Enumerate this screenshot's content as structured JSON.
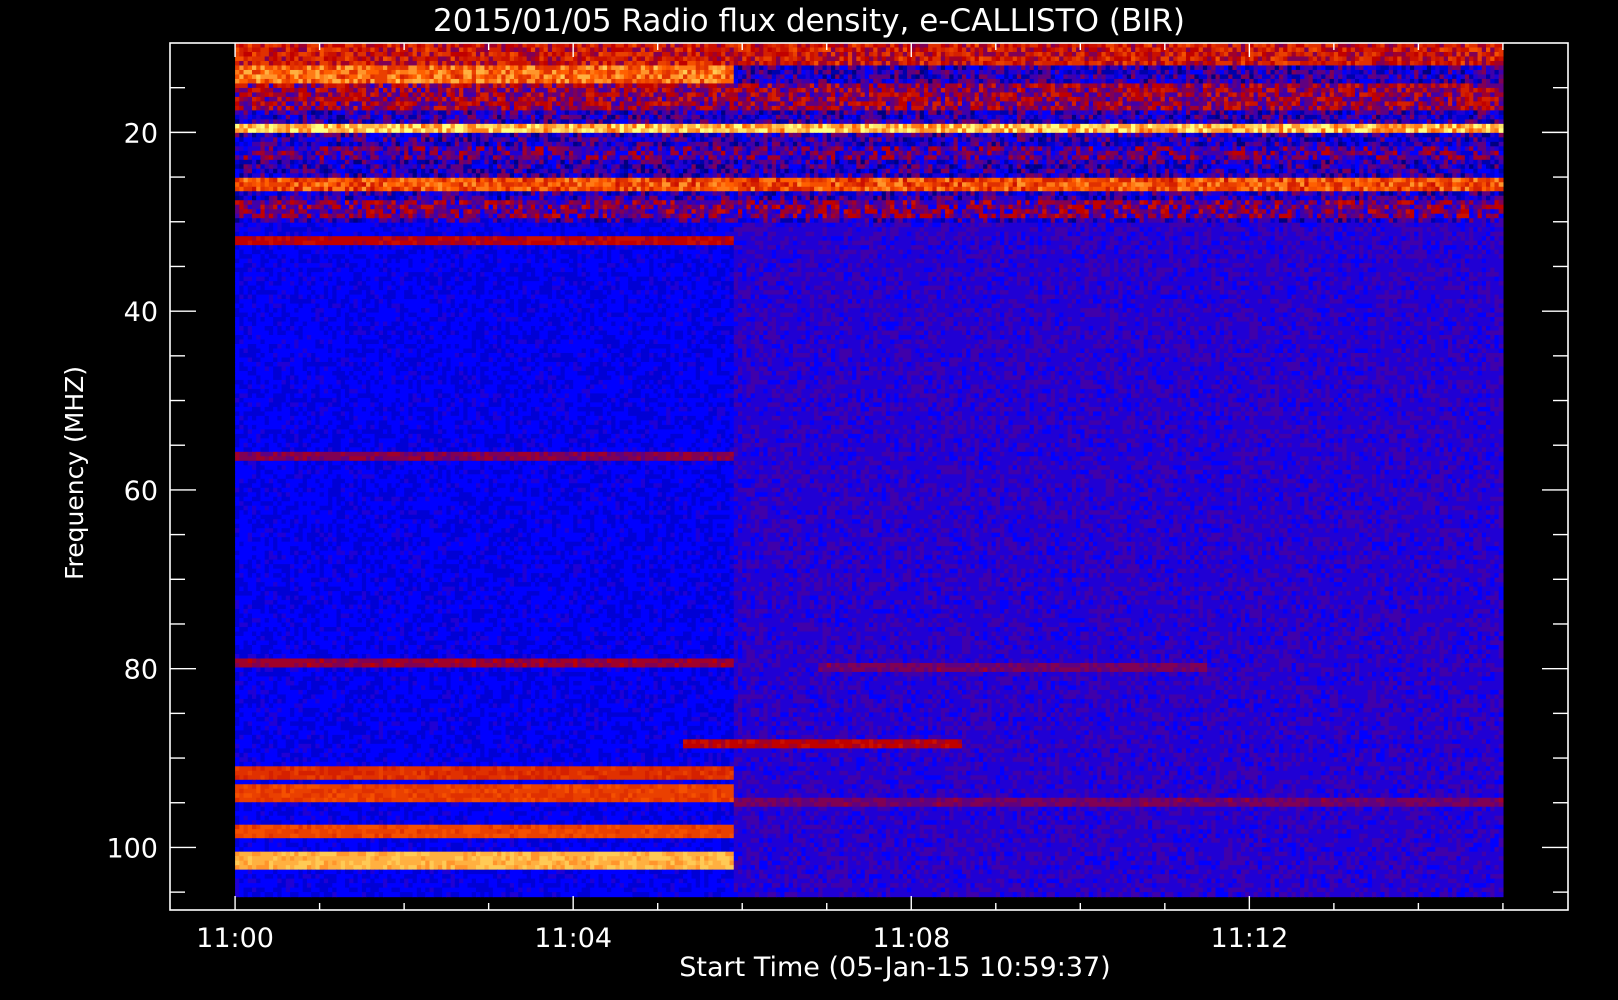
{
  "chart_data": {
    "type": "heatmap",
    "title": "2015/01/05  Radio flux density, e-CALLISTO (BIR)",
    "xlabel": "Start Time (05-Jan-15 10:59:37)",
    "ylabel": "Frequency (MHZ)",
    "x_ticks": [
      "11:00",
      "11:04",
      "11:08",
      "11:12"
    ],
    "x_tick_minutes": [
      0,
      4,
      8,
      12
    ],
    "x_range_minutes": [
      -0.77,
      15.77
    ],
    "data_x_range_minutes": [
      0,
      15
    ],
    "y_ticks": [
      20,
      40,
      60,
      80,
      100
    ],
    "y_range_mhz": [
      10,
      107
    ],
    "data_y_range_mhz": [
      10,
      105.5
    ],
    "y_inverted": true,
    "colormap": [
      "#000000",
      "#0000ff",
      "#c00000",
      "#ff6000",
      "#ffff80"
    ],
    "bands": [
      {
        "f0": 10,
        "f1": 12.5,
        "intensity": 0.55,
        "t0": 0,
        "t1": 15
      },
      {
        "f0": 12.5,
        "f1": 14.5,
        "intensity": 0.75,
        "t0": 0,
        "t1": 5.9
      },
      {
        "f0": 14.5,
        "f1": 17.5,
        "intensity": 0.45,
        "t0": 0,
        "t1": 15
      },
      {
        "f0": 19.2,
        "f1": 20.2,
        "intensity": 0.9,
        "t0": 0,
        "t1": 15
      },
      {
        "f0": 21.5,
        "f1": 23,
        "intensity": 0.35,
        "t0": 0,
        "t1": 15
      },
      {
        "f0": 25,
        "f1": 26.5,
        "intensity": 0.7,
        "t0": 0,
        "t1": 15
      },
      {
        "f0": 27.5,
        "f1": 29.5,
        "intensity": 0.4,
        "t0": 0,
        "t1": 15
      },
      {
        "f0": 31.5,
        "f1": 32.5,
        "intensity": 0.5,
        "t0": 0,
        "t1": 5.9
      },
      {
        "f0": 33,
        "f1": 35,
        "intensity": 0.08,
        "t0": 0,
        "t1": 5.9
      },
      {
        "f0": 40.5,
        "f1": 42.5,
        "intensity": 0.1,
        "t0": 0,
        "t1": 5.9
      },
      {
        "f0": 55.5,
        "f1": 56.5,
        "intensity": 0.42,
        "t0": 0,
        "t1": 5.9
      },
      {
        "f0": 72,
        "f1": 73,
        "intensity": 0.15,
        "t0": 0,
        "t1": 5.9
      },
      {
        "f0": 79,
        "f1": 80,
        "intensity": 0.45,
        "t0": 0,
        "t1": 5.9
      },
      {
        "f0": 88,
        "f1": 89,
        "intensity": 0.5,
        "t0": 5.3,
        "t1": 8.6
      },
      {
        "f0": 91,
        "f1": 92.5,
        "intensity": 0.62,
        "t0": 0,
        "t1": 5.9
      },
      {
        "f0": 93,
        "f1": 95,
        "intensity": 0.66,
        "t0": 0,
        "t1": 5.9
      },
      {
        "f0": 97.5,
        "f1": 99,
        "intensity": 0.68,
        "t0": 0,
        "t1": 5.9
      },
      {
        "f0": 100.5,
        "f1": 102.5,
        "intensity": 0.88,
        "t0": 0,
        "t1": 5.9
      },
      {
        "f0": 103.5,
        "f1": 104.5,
        "intensity": 0.2,
        "t0": 0,
        "t1": 5.9
      },
      {
        "f0": 94.5,
        "f1": 95.5,
        "intensity": 0.4,
        "t0": 5.9,
        "t1": 15
      },
      {
        "f0": 79.5,
        "f1": 80.5,
        "intensity": 0.4,
        "t0": 6.9,
        "t1": 11.5
      }
    ]
  }
}
